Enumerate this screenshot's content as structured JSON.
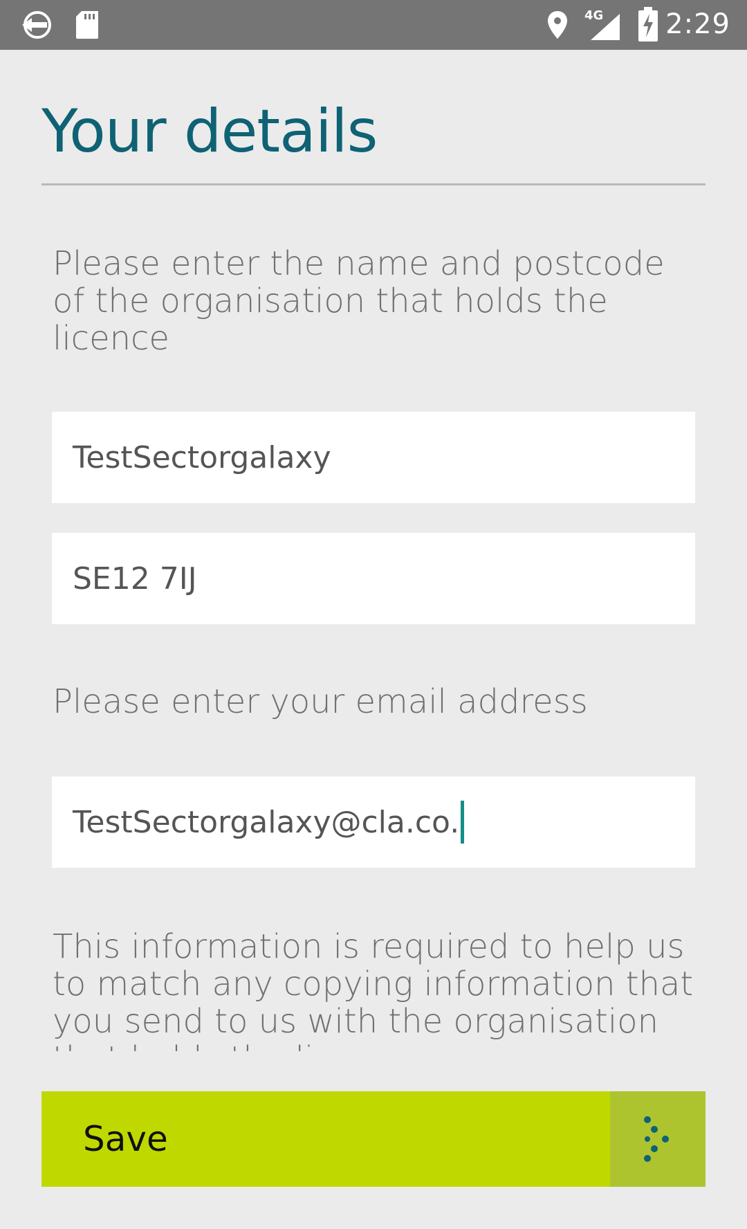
{
  "status_bar": {
    "time": "2:29",
    "network": "4G",
    "icons": [
      "app-icon",
      "sd-card-icon",
      "location-icon",
      "signal-icon",
      "battery-charging-icon"
    ]
  },
  "page": {
    "title": "Your details",
    "intro": "Please enter the name and postcode of the organisation that holds the licence",
    "email_prompt": "Please enter your email address",
    "info": "This information is required to help us to match any copying information that you send to us with the organisation that holds the licence"
  },
  "form": {
    "organisation_name": "TestSectorgalaxy",
    "postcode": "SE12 7IJ",
    "email": "TestSectorgalaxy@cla.co."
  },
  "actions": {
    "save_label": "Save",
    "save_icon": "dotted-chevron-right-icon"
  },
  "colors": {
    "title": "#0e6274",
    "save_button": "#bfd900",
    "save_arrow_bg": "#adc42f",
    "caret": "#138f86",
    "status_bar": "#757575"
  }
}
